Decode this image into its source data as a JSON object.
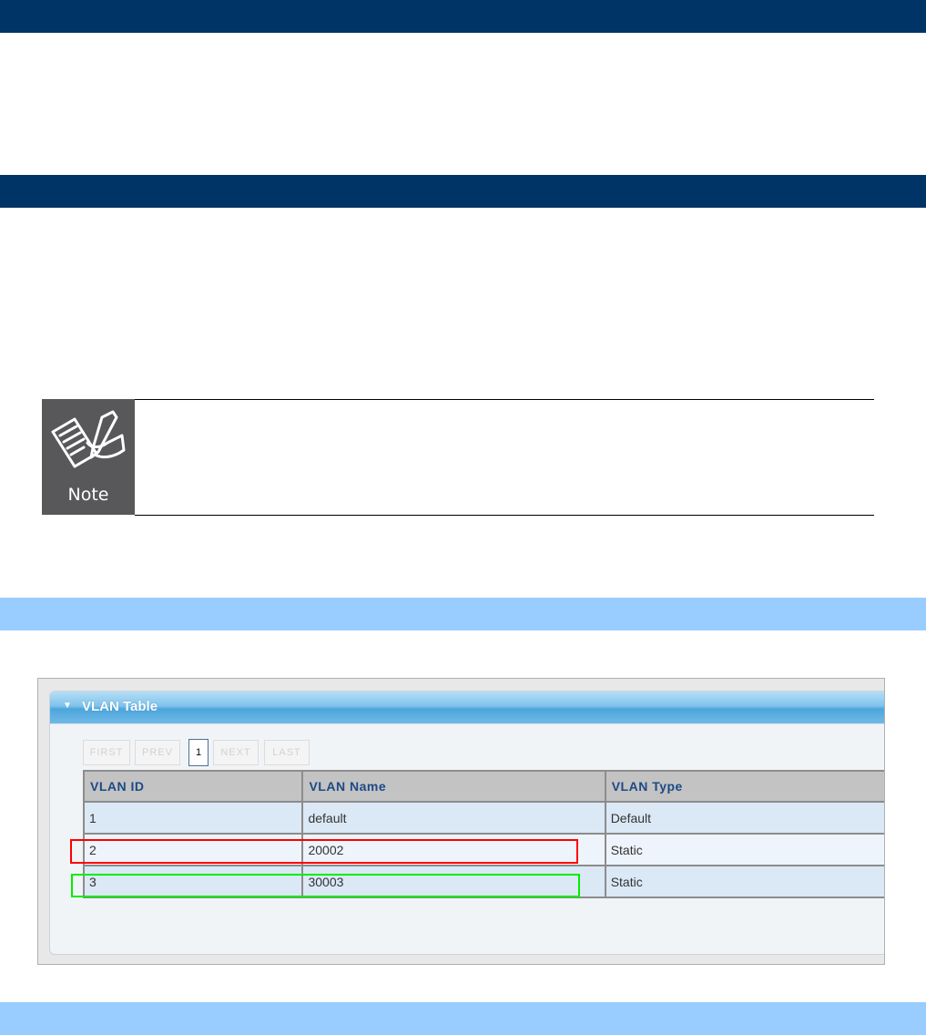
{
  "colors": {
    "dark_band": "#003366",
    "light_band": "#99ccff",
    "highlight_red": "#ff0000",
    "highlight_green": "#00ee00"
  },
  "note": {
    "label": "Note",
    "icon": "note-pencil-icon"
  },
  "vlan_panel": {
    "title": "VLAN Table",
    "collapse_icon": "triangle-down-icon",
    "pager": {
      "first": "FIRST",
      "prev": "PREV",
      "current": "1",
      "next": "NEXT",
      "last": "LAST"
    },
    "columns": [
      "VLAN ID",
      "VLAN Name",
      "VLAN Type"
    ],
    "rows": [
      [
        "1",
        "default",
        "Default"
      ],
      [
        "2",
        "20002",
        "Static"
      ],
      [
        "3",
        "30003",
        "Static"
      ]
    ]
  }
}
